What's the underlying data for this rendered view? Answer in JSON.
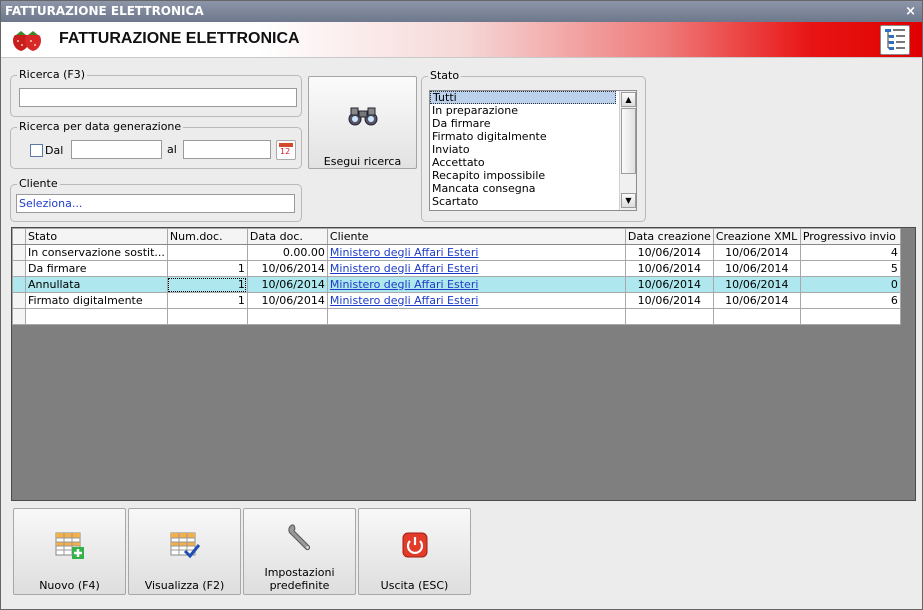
{
  "window": {
    "title": "FATTURAZIONE ELETTRONICA",
    "close_glyph": "×"
  },
  "banner": {
    "title": "FATTURAZIONE ELETTRONICA",
    "logo_icon": "strawberry-logo",
    "doc_icon": "document-list-icon"
  },
  "search": {
    "legend": "Ricerca (F3)",
    "value": ""
  },
  "date_search": {
    "legend": "Ricerca per data generazione",
    "checkbox_label": "Dal",
    "checked": false,
    "from_value": "",
    "to_label": "al",
    "to_value": "",
    "calendar_icon_text": "12"
  },
  "run_search": {
    "label": "Esegui ricerca",
    "icon": "binoculars-icon"
  },
  "client": {
    "legend": "Cliente",
    "value": "Seleziona..."
  },
  "status": {
    "legend": "Stato",
    "items": [
      "Tutti",
      "In preparazione",
      "Da firmare",
      "Firmato digitalmente",
      "Inviato",
      "Accettato",
      "Recapito impossibile",
      "Mancata consegna",
      "Scartato"
    ],
    "selected": "Tutti"
  },
  "grid": {
    "columns": [
      "Stato",
      "Num.doc.",
      "Data doc.",
      "Cliente",
      "Data creazione",
      "Creazione XML",
      "Progressivo invio"
    ],
    "rows": [
      {
        "stato": "In conservazione sostit...",
        "num": "",
        "data_doc": "0.00.00",
        "cliente": "Ministero degli Affari Esteri",
        "data_creazione": "10/06/2014",
        "creazione_xml": "10/06/2014",
        "progressivo": "4"
      },
      {
        "stato": "Da firmare",
        "num": "1",
        "data_doc": "10/06/2014",
        "cliente": "Ministero degli Affari Esteri",
        "data_creazione": "10/06/2014",
        "creazione_xml": "10/06/2014",
        "progressivo": "5"
      },
      {
        "stato": "Annullata",
        "num": "1",
        "data_doc": "10/06/2014",
        "cliente": "Ministero degli Affari Esteri",
        "data_creazione": "10/06/2014",
        "creazione_xml": "10/06/2014",
        "progressivo": "0"
      },
      {
        "stato": "Firmato digitalmente",
        "num": "1",
        "data_doc": "10/06/2014",
        "cliente": "Ministero degli Affari Esteri",
        "data_creazione": "10/06/2014",
        "creazione_xml": "10/06/2014",
        "progressivo": "6"
      }
    ],
    "selected_row": 2,
    "selected_row_color": "#aee8ee"
  },
  "buttons": {
    "new": {
      "label": "Nuovo (F4)",
      "icon": "grid-add-icon"
    },
    "view": {
      "label": "Visualizza (F2)",
      "icon": "grid-check-icon"
    },
    "defaults_line1": "Impostazioni",
    "defaults_line2": "predefinite",
    "defaults_icon": "wrench-icon",
    "exit": {
      "label": "Uscita (ESC)",
      "icon": "power-icon"
    }
  },
  "colors": {
    "banner_red": "#e00000",
    "link": "#1d3cc8",
    "grid_bg": "#7f7f7f"
  }
}
